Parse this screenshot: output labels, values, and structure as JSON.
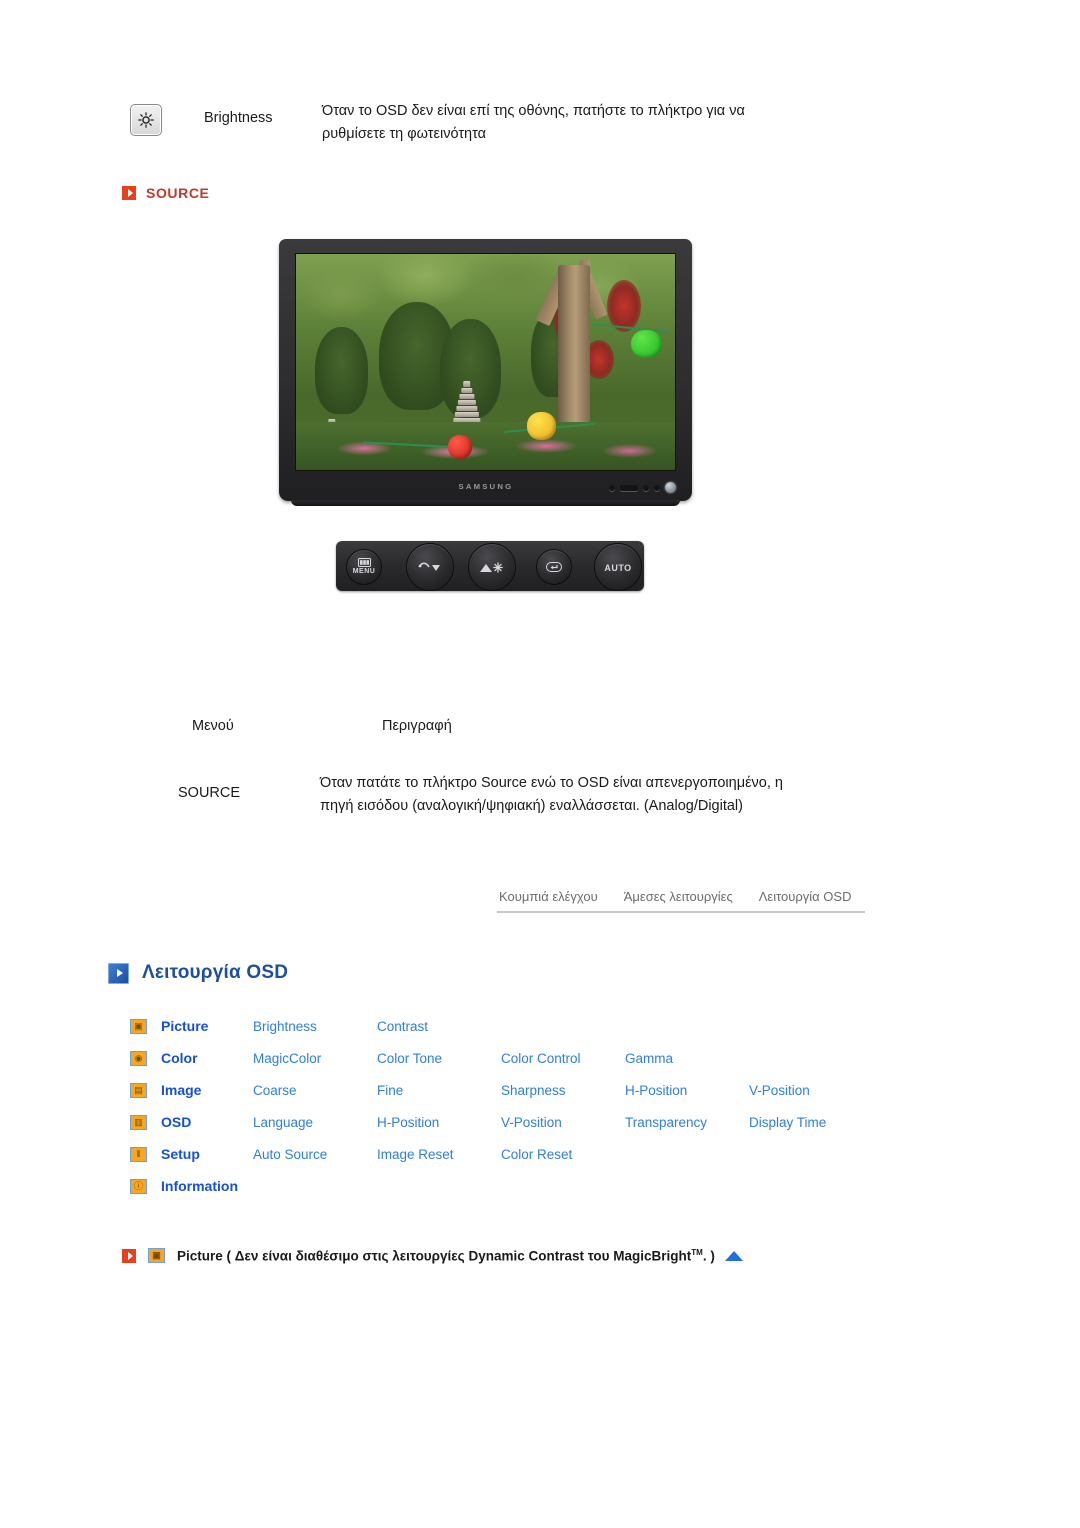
{
  "direct_function": {
    "icon": "brightness-sun-icon",
    "label": "Brightness",
    "description": "Όταν το OSD δεν είναι επί της οθόνης, πατήστε το πλήκτρο για να ρυθμίσετε τη φωτεινότητα"
  },
  "source_section": {
    "marker_icon": "red-play-marker-icon",
    "heading": "SOURCE",
    "marker_color": "#e8401c",
    "heading_color": "#c0392b"
  },
  "monitor": {
    "brand": "SAMSUNG",
    "screen_content": "garden scene with stone pagodas, trees and paper lanterns"
  },
  "control_buttons": [
    {
      "name": "menu-button",
      "caption": "MENU",
      "icon": "osd-menu-icon"
    },
    {
      "name": "down-button",
      "caption": "",
      "icon": "down-arrow-icon"
    },
    {
      "name": "brightness-button",
      "caption": "",
      "icon": "brightness-icon"
    },
    {
      "name": "enter-button",
      "caption": "",
      "icon": "enter-icon"
    },
    {
      "name": "auto-button",
      "caption": "AUTO",
      "icon": "auto-icon"
    }
  ],
  "menu_table": {
    "headers": {
      "menu": "Μενού",
      "description": "Περιγραφή"
    },
    "rows": [
      {
        "menu": "SOURCE",
        "description": "Όταν πατάτε το πλήκτρο Source ενώ το OSD είναι απενεργοποιημένο, η πηγή εισόδου (αναλογική/ψηφιακή) εναλλάσσεται. (Analog/Digital)"
      }
    ]
  },
  "tabstrip": {
    "tabs": [
      "Κουμπιά ελέγχου",
      "Άμεσες λειτουργίες",
      "Λειτουργία OSD"
    ]
  },
  "section": {
    "marker_icon": "blue-play-marker-icon",
    "title": "Λειτουργία OSD",
    "title_color": "#1c4f9c"
  },
  "osd_menu": {
    "icon_fill": "#f5a623",
    "icon_border": "#6ba3e0",
    "category_color": "#1550d8",
    "item_color": "#2f7fdb",
    "rows": [
      {
        "icon": "picture-icon",
        "icon_glyph": "▣",
        "category": "Picture",
        "items": [
          "Brightness",
          "Contrast"
        ]
      },
      {
        "icon": "color-palette-icon",
        "icon_glyph": "◉",
        "category": "Color",
        "items": [
          "MagicColor",
          "Color Tone",
          "Color Control",
          "Gamma"
        ]
      },
      {
        "icon": "image-icon",
        "icon_glyph": "▤",
        "category": "Image",
        "items": [
          "Coarse",
          "Fine",
          "Sharpness",
          "H-Position",
          "V-Position"
        ]
      },
      {
        "icon": "osd-window-icon",
        "icon_glyph": "▥",
        "category": "OSD",
        "items": [
          "Language",
          "H-Position",
          "V-Position",
          "Transparency",
          "Display Time"
        ]
      },
      {
        "icon": "setup-sliders-icon",
        "icon_glyph": "⦀",
        "category": "Setup",
        "items": [
          "Auto Source",
          "Image Reset",
          "Color Reset"
        ]
      },
      {
        "icon": "information-icon",
        "icon_glyph": "ⓘ",
        "category": "Information",
        "items": []
      }
    ]
  },
  "footnote": {
    "marker_icon": "red-play-marker-icon",
    "badge_icon": "picture-icon",
    "badge_glyph": "▣",
    "text_before": "Picture ( Δεν είναι διαθέσιμο στις λειτουργίες Dynamic Contrast του MagicBright",
    "superscript": "TM",
    "text_after": ". )",
    "back_to_top_icon": "up-triangle-icon"
  }
}
